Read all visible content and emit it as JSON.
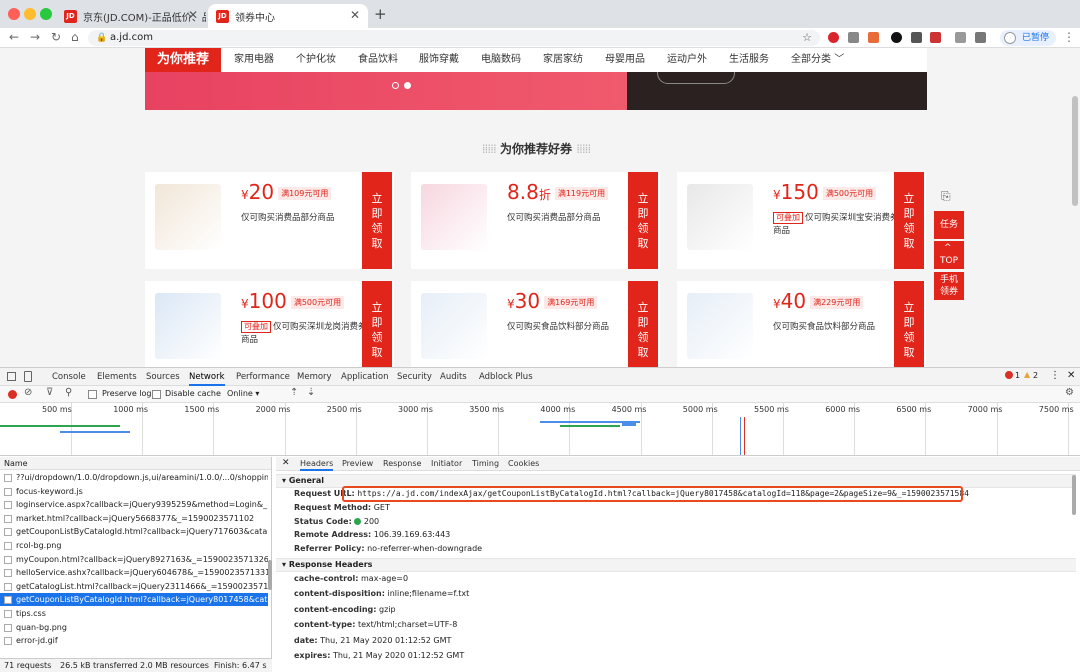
{
  "browser": {
    "tabs": [
      {
        "favicon": "JD",
        "title": "京东(JD.COM)-正品低价、品质",
        "active": false
      },
      {
        "favicon": "JD",
        "title": "领券中心",
        "active": true
      }
    ],
    "new_tab": "+",
    "url": "a.jd.com",
    "paused_label": "已暂停"
  },
  "page": {
    "category_active": "为你推荐",
    "categories": [
      "家用电器",
      "个护化妆",
      "食品饮料",
      "服饰穿戴",
      "电脑数码",
      "家居家纺",
      "母婴用品",
      "运动户外",
      "生活服务",
      "全部分类"
    ],
    "section_title": "为你推荐好券",
    "claim_label": [
      "立",
      "即",
      "领",
      "取"
    ],
    "coupons": [
      {
        "amount": "20",
        "prefix": "¥",
        "suffix": "",
        "condition": "满109元可用",
        "tag": "",
        "desc": "仅可购买消费品部分商品",
        "image": "laundry-bottles",
        "color": "#f1e6d8"
      },
      {
        "amount": "8.8",
        "prefix": "",
        "suffix": "折",
        "condition": "满119元可用",
        "tag": "",
        "desc": "仅可购买消费品部分商品",
        "image": "dove-bodywash",
        "color": "#f7d6e0"
      },
      {
        "amount": "150",
        "prefix": "¥",
        "suffix": "",
        "condition": "满500元可用",
        "tag": "可叠加",
        "desc": "仅可购买深圳宝安消费券补贴商品",
        "image": "electric-fan",
        "color": "#e8e8e8"
      },
      {
        "amount": "100",
        "prefix": "¥",
        "suffix": "",
        "condition": "满500元可用",
        "tag": "可叠加",
        "desc": "仅可购买深圳龙岗消费券补贴商品",
        "image": "usb-cable",
        "color": "#dbe7f5"
      },
      {
        "amount": "30",
        "prefix": "¥",
        "suffix": "",
        "condition": "满169元可用",
        "tag": "",
        "desc": "仅可购买食品饮料部分商品",
        "image": "milk-box",
        "color": "#e6eef7"
      },
      {
        "amount": "40",
        "prefix": "¥",
        "suffix": "",
        "condition": "满229元可用",
        "tag": "",
        "desc": "仅可购买食品饮料部分商品",
        "image": "milk-box",
        "color": "#e6eef7"
      }
    ],
    "side": {
      "task": "任务",
      "top": "TOP",
      "mobile": "手机\n领券"
    }
  },
  "devtools": {
    "tabs": [
      "Console",
      "Elements",
      "Sources",
      "Network",
      "Performance",
      "Memory",
      "Application",
      "Security",
      "Audits",
      "Adblock Plus"
    ],
    "active_tab": "Network",
    "errors": "1",
    "warnings": "2",
    "toolbar": {
      "preserve_log": "Preserve log",
      "disable_cache": "Disable cache",
      "throttle": "Online"
    },
    "timeline_ticks": [
      "500 ms",
      "1000 ms",
      "1500 ms",
      "2000 ms",
      "2500 ms",
      "3000 ms",
      "3500 ms",
      "4000 ms",
      "4500 ms",
      "5000 ms",
      "5500 ms",
      "6000 ms",
      "6500 ms",
      "7000 ms",
      "7500 ms"
    ],
    "name_header": "Name",
    "requests": [
      "??ui/dropdown/1.0.0/dropdown.js,ui/areamini/1.0.0/...0/shoppingcart.j",
      "focus-keyword.js",
      "loginservice.aspx?callback=jQuery9395259&method=Login&_=159002",
      "market.html?callback=jQuery5668377&_=1590023571102",
      "getCouponListByCatalogId.html?callback=jQuery717603&catalogId=1.",
      "rcol-bg.png",
      "myCoupon.html?callback=jQuery8927163&_=1590023571326",
      "helloService.ashx?callback=jQuery604678&_=1590023571331",
      "getCatalogList.html?callback=jQuery2311466&_=1590023571398",
      "getCouponListByCatalogId.html?callback=jQuery8017458&catalogId=..",
      "tips.css",
      "quan-bg.png",
      "error-jd.gif"
    ],
    "selected_request": 9,
    "status_bar": {
      "requests": "71 requests",
      "transferred": "26.5 kB transferred",
      "resources": "2.0 MB resources",
      "finish": "Finish: 6.47 s"
    },
    "detail_tabs": [
      "Headers",
      "Preview",
      "Response",
      "Initiator",
      "Timing",
      "Cookies"
    ],
    "detail_active": "Headers",
    "general_title": "General",
    "general": [
      {
        "key": "Request URL:",
        "value": "https://a.jd.com/indexAjax/getCouponListByCatalogId.html?callback=jQuery8017458&catalogId=118&page=2&pageSize=9&_=1590023571584"
      },
      {
        "key": "Request Method:",
        "value": "GET"
      },
      {
        "key": "Status Code:",
        "value": "200"
      },
      {
        "key": "Remote Address:",
        "value": "106.39.169.63:443"
      },
      {
        "key": "Referrer Policy:",
        "value": "no-referrer-when-downgrade"
      }
    ],
    "response_title": "Response Headers",
    "response_headers": [
      {
        "key": "cache-control:",
        "value": "max-age=0"
      },
      {
        "key": "content-disposition:",
        "value": "inline;filename=f.txt"
      },
      {
        "key": "content-encoding:",
        "value": "gzip"
      },
      {
        "key": "content-type:",
        "value": "text/html;charset=UTF-8"
      },
      {
        "key": "date:",
        "value": "Thu, 21 May 2020 01:12:52 GMT"
      },
      {
        "key": "expires:",
        "value": "Thu, 21 May 2020 01:12:52 GMT"
      }
    ]
  }
}
